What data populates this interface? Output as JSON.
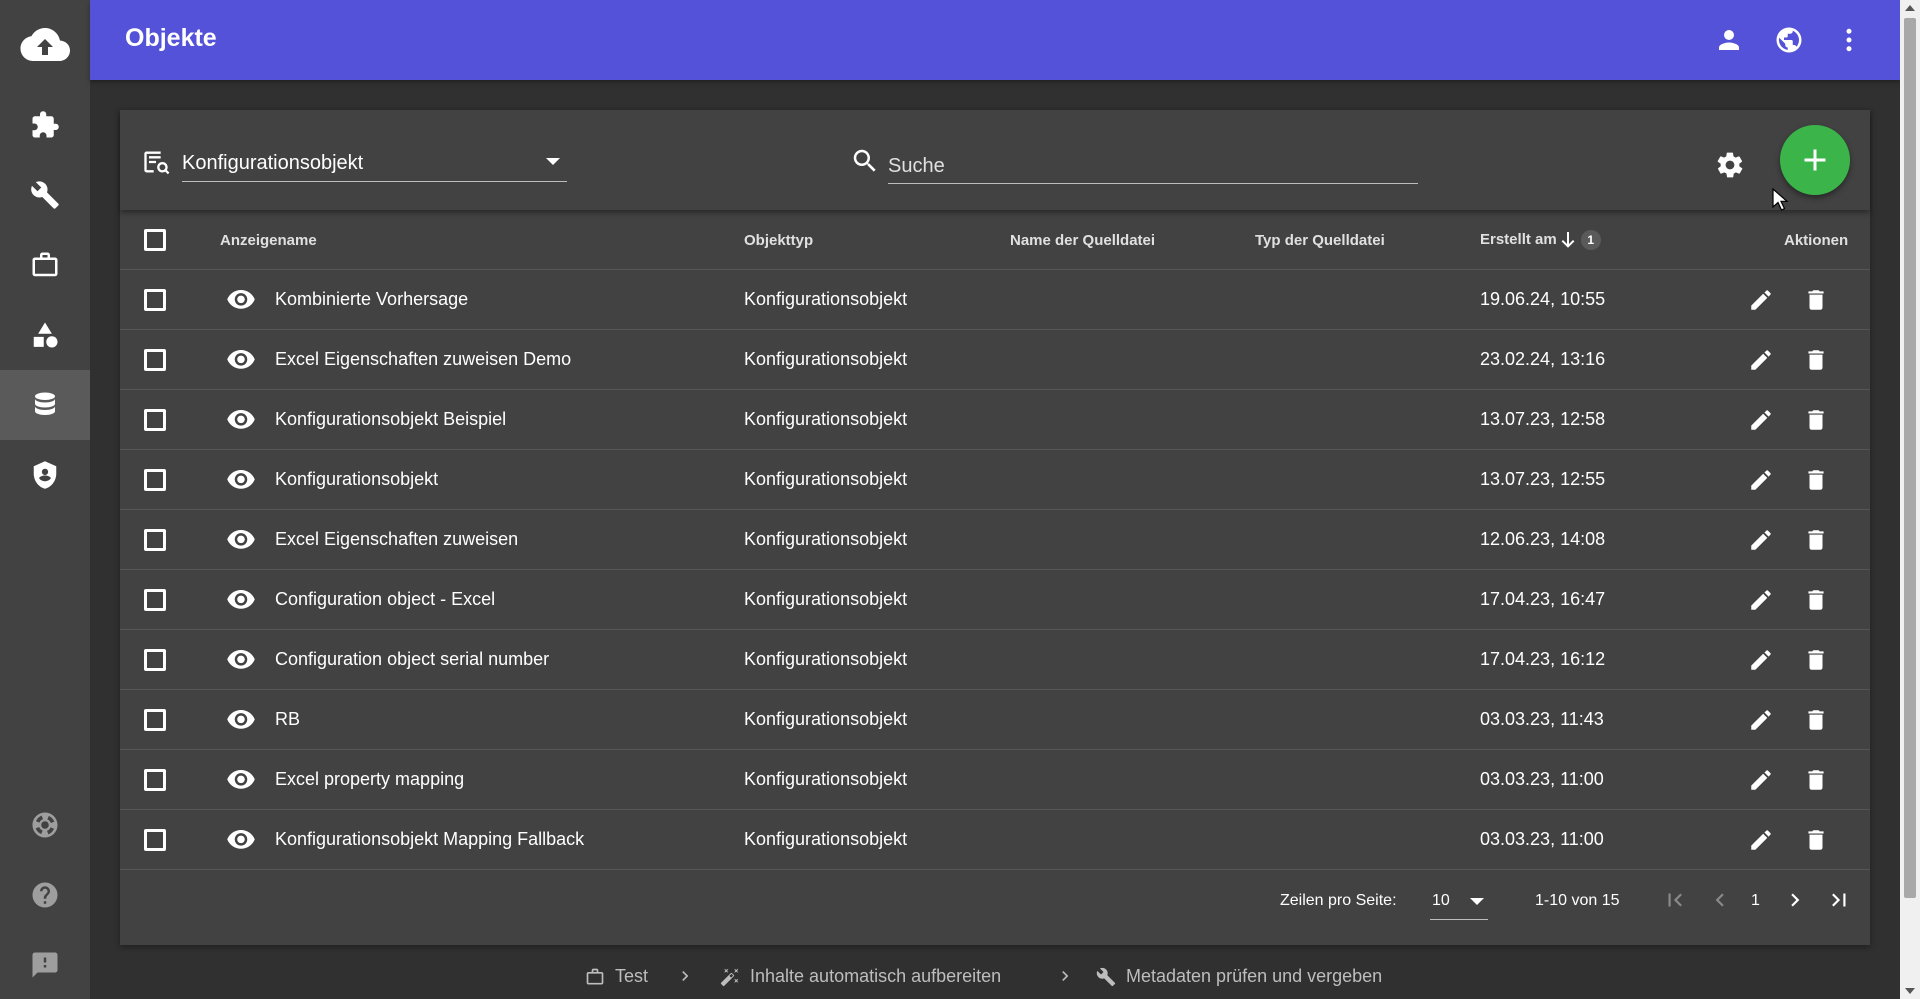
{
  "header": {
    "title": "Objekte"
  },
  "toolbar": {
    "object_type": "Konfigurationsobjekt",
    "search_placeholder": "Suche"
  },
  "table": {
    "headers": {
      "name": "Anzeigename",
      "type": "Objekttyp",
      "source_name": "Name der Quelldatei",
      "source_type": "Typ der Quelldatei",
      "created": "Erstellt am",
      "sort_index": "1",
      "actions": "Aktionen"
    },
    "rows": [
      {
        "name": "Kombinierte Vorhersage",
        "type": "Konfigurationsobjekt",
        "source_name": "",
        "source_type": "",
        "created": "19.06.24, 10:55"
      },
      {
        "name": "Excel Eigenschaften zuweisen Demo",
        "type": "Konfigurationsobjekt",
        "source_name": "",
        "source_type": "",
        "created": "23.02.24, 13:16"
      },
      {
        "name": "Konfigurationsobjekt Beispiel",
        "type": "Konfigurationsobjekt",
        "source_name": "",
        "source_type": "",
        "created": "13.07.23, 12:58"
      },
      {
        "name": "Konfigurationsobjekt",
        "type": "Konfigurationsobjekt",
        "source_name": "",
        "source_type": "",
        "created": "13.07.23, 12:55"
      },
      {
        "name": "Excel Eigenschaften zuweisen",
        "type": "Konfigurationsobjekt",
        "source_name": "",
        "source_type": "",
        "created": "12.06.23, 14:08"
      },
      {
        "name": "Configuration object - Excel",
        "type": "Konfigurationsobjekt",
        "source_name": "",
        "source_type": "",
        "created": "17.04.23, 16:47"
      },
      {
        "name": "Configuration object serial number",
        "type": "Konfigurationsobjekt",
        "source_name": "",
        "source_type": "",
        "created": "17.04.23, 16:12"
      },
      {
        "name": "RB",
        "type": "Konfigurationsobjekt",
        "source_name": "",
        "source_type": "",
        "created": "03.03.23, 11:43"
      },
      {
        "name": "Excel property mapping",
        "type": "Konfigurationsobjekt",
        "source_name": "",
        "source_type": "",
        "created": "03.03.23, 11:00"
      },
      {
        "name": "Konfigurationsobjekt Mapping Fallback",
        "type": "Konfigurationsobjekt",
        "source_name": "",
        "source_type": "",
        "created": "03.03.23, 11:00"
      }
    ]
  },
  "paginator": {
    "rows_label": "Zeilen pro Seite:",
    "page_size": "10",
    "range": "1-10 von 15",
    "page": "1"
  },
  "workflow": {
    "steps": [
      "Test",
      "Inhalte automatisch aufbereiten",
      "Metadaten prüfen und vergeben"
    ]
  },
  "colors": {
    "header": "#5352d8",
    "sidebar": "#424242",
    "background": "#303030",
    "card": "#424242",
    "fab": "#3bb54a"
  },
  "icons": {
    "sidebar": [
      "cloud-upload-icon",
      "puzzle-icon",
      "wrench-icon",
      "briefcase-icon",
      "shapes-icon",
      "database-icon",
      "shield-icon",
      "lifebuoy-icon",
      "help-icon",
      "feedback-icon"
    ],
    "header": [
      "person-icon",
      "globe-icon",
      "more-vert-icon"
    ]
  }
}
